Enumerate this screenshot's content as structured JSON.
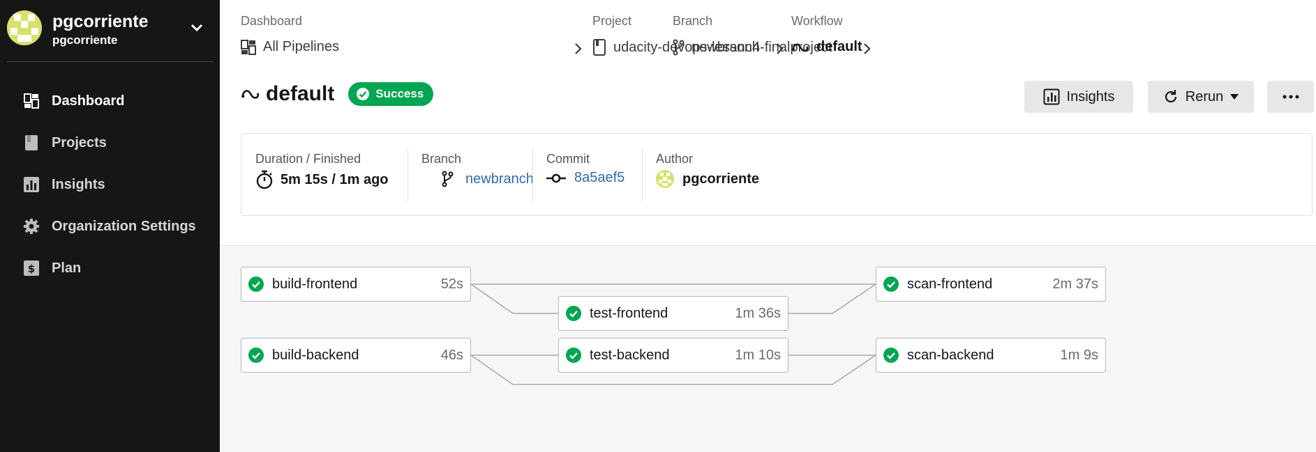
{
  "org": {
    "name": "pgcorriente",
    "subname": "pgcorriente"
  },
  "nav": [
    {
      "label": "Dashboard",
      "icon": "dashboard-icon"
    },
    {
      "label": "Projects",
      "icon": "projects-icon"
    },
    {
      "label": "Insights",
      "icon": "insights-icon"
    },
    {
      "label": "Organization Settings",
      "icon": "gear-icon"
    },
    {
      "label": "Plan",
      "icon": "plan-icon"
    }
  ],
  "breadcrumbs": [
    {
      "caption": "Dashboard",
      "label": "All Pipelines",
      "icon": "pipelines-icon"
    },
    {
      "caption": "Project",
      "label": "udacity-devops-lesson4-finalproject",
      "icon": "project-icon"
    },
    {
      "caption": "Branch",
      "label": "newbranch",
      "icon": "branch-icon"
    },
    {
      "caption": "Workflow",
      "label": "default",
      "icon": "workflow-icon"
    }
  ],
  "workflow": {
    "title": "default",
    "status": "Success",
    "status_color": "#00a651"
  },
  "actions": {
    "insights": "Insights",
    "rerun": "Rerun"
  },
  "summary": {
    "duration_caption": "Duration / Finished",
    "duration_value": "5m 15s / 1m ago",
    "branch_caption": "Branch",
    "branch_value": "newbranch",
    "commit_caption": "Commit",
    "commit_value": "8a5aef5",
    "author_caption": "Author",
    "author_value": "pgcorriente"
  },
  "jobs": [
    {
      "name": "build-frontend",
      "duration": "52s",
      "status": "success"
    },
    {
      "name": "test-frontend",
      "duration": "1m 36s",
      "status": "success"
    },
    {
      "name": "scan-frontend",
      "duration": "2m 37s",
      "status": "success"
    },
    {
      "name": "build-backend",
      "duration": "46s",
      "status": "success"
    },
    {
      "name": "test-backend",
      "duration": "1m 10s",
      "status": "success"
    },
    {
      "name": "scan-backend",
      "duration": "1m 9s",
      "status": "success"
    }
  ],
  "colors": {
    "sidebar_bg": "#161616",
    "success": "#00a651",
    "link": "#2b6cb0"
  }
}
